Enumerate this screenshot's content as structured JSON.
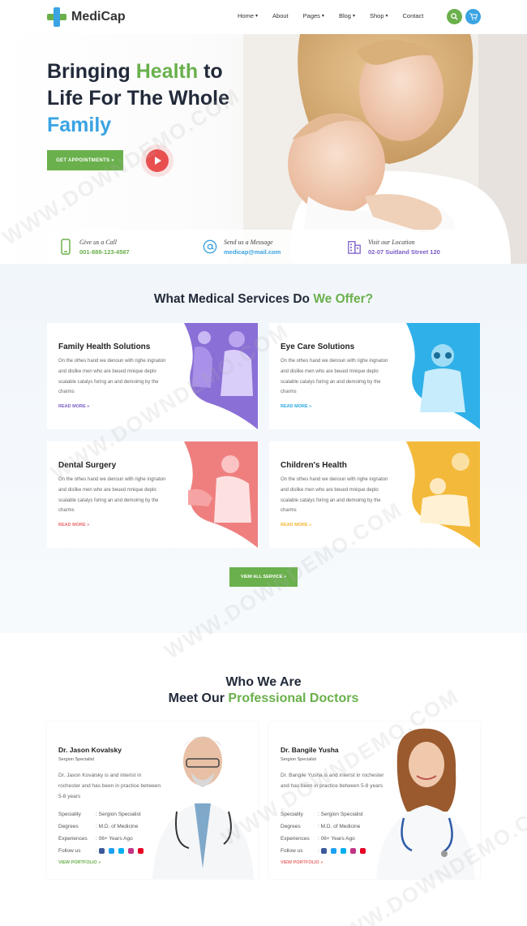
{
  "brand": {
    "name": "MediCap",
    "green": "#6ab04c",
    "blue": "#3aa3e3",
    "dark": "#222a3a"
  },
  "nav": {
    "items": [
      {
        "label": "Home",
        "dropdown": true
      },
      {
        "label": "About",
        "dropdown": false
      },
      {
        "label": "Pages",
        "dropdown": true
      },
      {
        "label": "Blog",
        "dropdown": true
      },
      {
        "label": "Shop",
        "dropdown": true
      },
      {
        "label": "Contact",
        "dropdown": false
      }
    ],
    "search_icon": "search-icon",
    "cart_icon": "cart-icon"
  },
  "hero": {
    "title_part1": "Bringing ",
    "title_health": "Health",
    "title_part2": " to Life For The Whole ",
    "title_family": "Family",
    "appointment_button": "GET APPOINTMENTS »",
    "play_icon": "play-icon"
  },
  "contacts": [
    {
      "label": "Give us a Call",
      "value": "001-888-123-4567",
      "color": "#6ab04c",
      "icon": "phone-icon"
    },
    {
      "label": "Send us a Message",
      "value": "medicap@mail.com",
      "color": "#3aa3e3",
      "icon": "at-icon"
    },
    {
      "label": "Visit our Location",
      "value": "02-07 Suitland Street 120",
      "color": "#7b5cc8",
      "icon": "building-icon"
    }
  ],
  "services": {
    "title_part1": "What Medical Services Do ",
    "title_part2": "We Offer?",
    "cards": [
      {
        "title": "Family Health Solutions",
        "text": "On the othes hand we denoun with righe ingnaton and dislike men who are beued mnique deplo scalable catalys foring an and demoimg by the charms",
        "link": "READ MORE »",
        "accent": "#7b5cc8"
      },
      {
        "title": "Eye Care Solutions",
        "text": "On the othes hand we denoun with righe ingnaton and dislike men who are beued mnique deplo scalable catalys foring an and demoimg by the charms",
        "link": "READ MORE »",
        "accent": "#29a8e0"
      },
      {
        "title": "Dental Surgery",
        "text": "On the othes hand we denoun with righe ingnaton and dislike men who are beued mnique deplo scalable catalys foring an and demoimg by the charms",
        "link": "READ MORE »",
        "accent": "#e96a6a"
      },
      {
        "title": "Children's Health",
        "text": "On the othes hand we denoun with righe ingnaton and dislike men who are beued mnique deplo scalable catalys foring an and demoimg by the charms",
        "link": "READ MORE »",
        "accent": "#f2b632"
      }
    ],
    "view_all": "VIEW ALL SERVICE »"
  },
  "team": {
    "title_line1": "Who We Are",
    "title_line2_part1": "Meet Our ",
    "title_line2_part2": "Professional Doctors",
    "doctors": [
      {
        "name": "Dr. Jason Kovalsky",
        "role": "Sergion Specialist",
        "bio": "Dr. Jason Kovalsky is and interist in rochester and has been in practice between 5-8 years",
        "speciality_label": "Speciality",
        "speciality": ": Sergion Specialist",
        "degrees_label": "Degrees",
        "degrees": ": M.D. of Medicine",
        "experiences_label": "Experiences",
        "experiences": ": 06+ Years Ago",
        "follow_label": "Follow us",
        "link": "VIEW PORTFOLIO »",
        "link_color": "#6ab04c"
      },
      {
        "name": "Dr. Bangile Yusha",
        "role": "Sergion Specialist",
        "bio": "Dr. Bangile Yusha is and interist in rochester and has been in practice between 5-8 years",
        "speciality_label": "Speciality",
        "speciality": ": Sergion Specialist",
        "degrees_label": "Degrees",
        "degrees": ": M.D. of Medicine",
        "experiences_label": "Experiences",
        "experiences": ": 06+ Years Ago",
        "follow_label": "Follow us",
        "link": "VIEW PORTFOLIO »",
        "link_color": "#e96a6a"
      }
    ],
    "social_icons": [
      "facebook-icon",
      "twitter-icon",
      "skype-icon",
      "instagram-icon",
      "pinterest-icon"
    ]
  },
  "watermark": "WWW.DOWNDEMO.COM"
}
